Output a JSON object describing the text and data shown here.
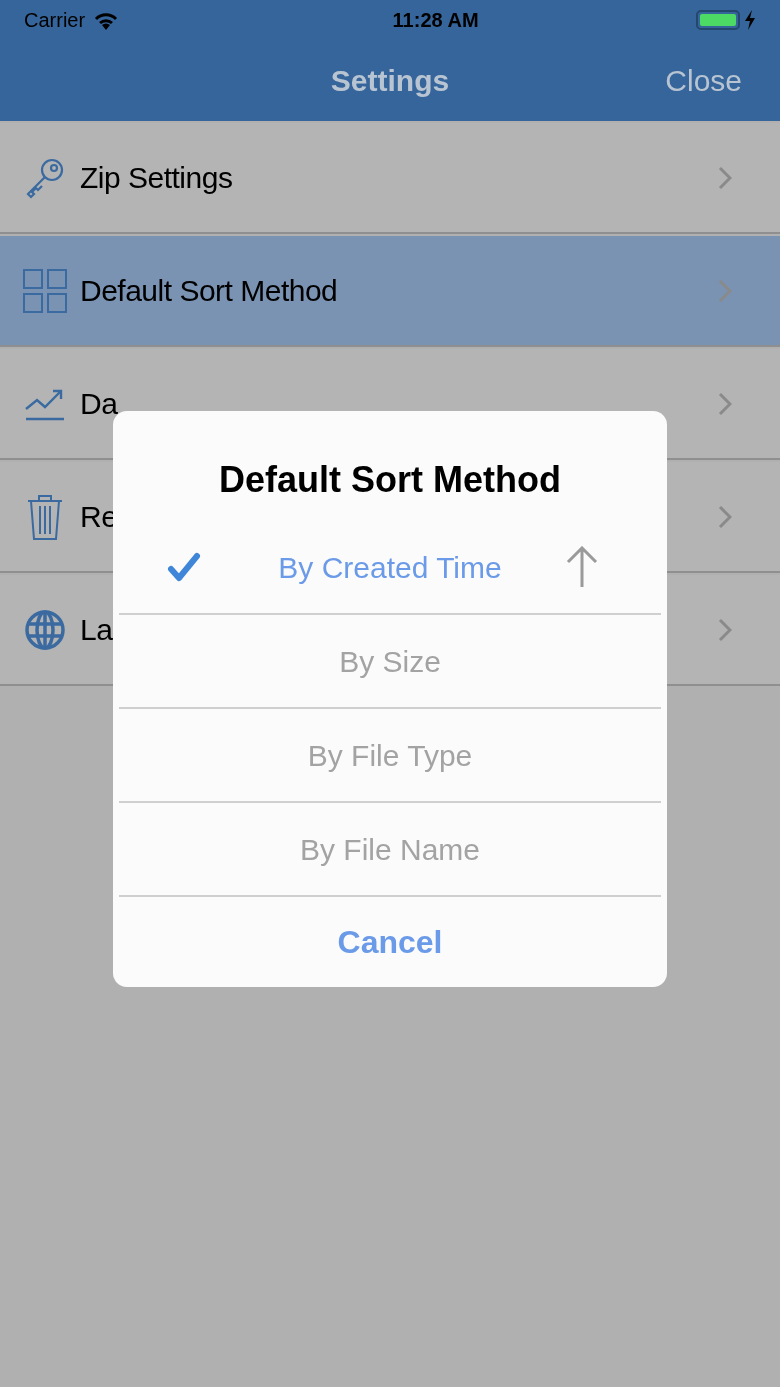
{
  "status_bar": {
    "carrier": "Carrier",
    "time": "11:28 AM",
    "battery": {
      "level": 1,
      "charging": true
    }
  },
  "nav": {
    "title": "Settings",
    "close": "Close"
  },
  "rows": [
    {
      "kind": "key",
      "label": "Zip Settings",
      "selected": false
    },
    {
      "kind": "grid",
      "label": "Default Sort Method",
      "selected": true
    },
    {
      "kind": "chart",
      "label": "Da",
      "selected": false
    },
    {
      "kind": "trash",
      "label": "Re",
      "selected": false
    },
    {
      "kind": "globe",
      "label": "La",
      "selected": false
    }
  ],
  "dialog": {
    "title": "Default Sort Method",
    "options": [
      {
        "label": "By Created Time",
        "selected": true,
        "ascending": true
      },
      {
        "label": "By Size",
        "selected": false
      },
      {
        "label": "By File Type",
        "selected": false
      },
      {
        "label": "By File Name",
        "selected": false
      }
    ],
    "cancel": "Cancel"
  }
}
